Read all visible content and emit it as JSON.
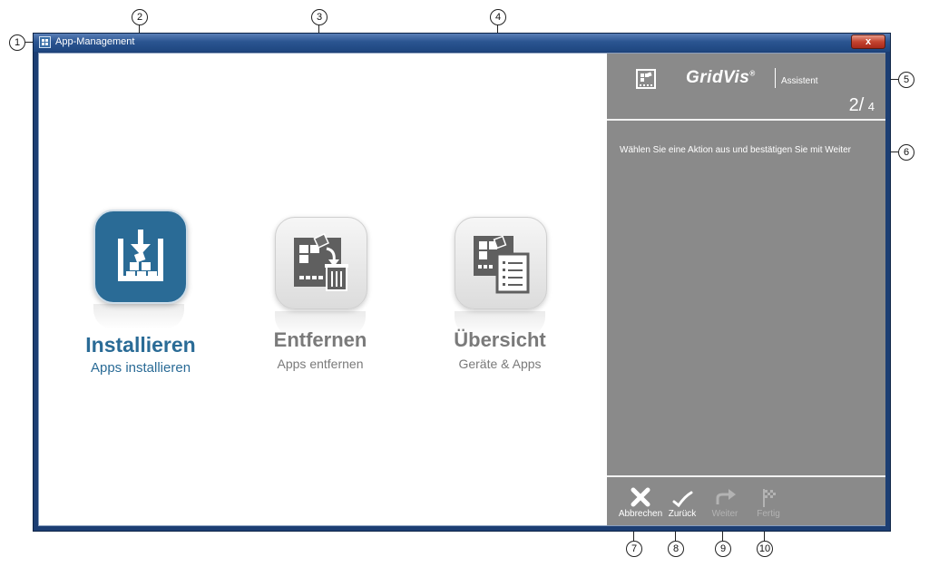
{
  "window": {
    "title": "App-Management",
    "close_label": "x"
  },
  "actions": [
    {
      "name": "Installieren",
      "subtitle": "Apps installieren",
      "icon": "install-icon",
      "color": "#2a6b96",
      "active": true
    },
    {
      "name": "Entfernen",
      "subtitle": "Apps entfernen",
      "icon": "remove-icon",
      "color": "#707070",
      "active": false
    },
    {
      "name": "Übersicht",
      "subtitle": "Geräte & Apps",
      "icon": "overview-icon",
      "color": "#707070",
      "active": false
    }
  ],
  "assistant": {
    "brand": "GridVis",
    "brand_mark": "®",
    "label": "Assistent",
    "step_current": "2",
    "step_separator": "/",
    "step_total": "4",
    "instruction": "Wählen Sie eine Aktion aus und bestätigen Sie mit Weiter",
    "panel_color": "#8a8a8a"
  },
  "buttons": [
    {
      "label": "Abbrechen",
      "icon": "cancel-icon",
      "enabled": true
    },
    {
      "label": "Zurück",
      "icon": "check-icon",
      "enabled": true
    },
    {
      "label": "Weiter",
      "icon": "forward-arrow-icon",
      "enabled": false
    },
    {
      "label": "Fertig",
      "icon": "finish-flag-icon",
      "enabled": false
    }
  ],
  "callouts": [
    "1",
    "2",
    "3",
    "4",
    "5",
    "6",
    "7",
    "8",
    "9",
    "10"
  ]
}
